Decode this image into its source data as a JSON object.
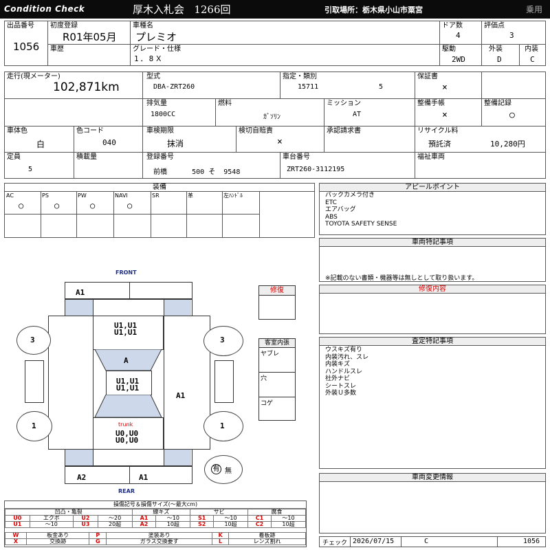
{
  "header": {
    "brand": "Condition Check",
    "auction": "厚木入札会",
    "lot_session": "1266回",
    "pickup": "引取場所：栃木県小山市粟宮",
    "category": "乗用"
  },
  "listing": {
    "lot_label": "出品番号",
    "lot_value": "1056",
    "first_reg_label": "初度登録",
    "first_reg_value": "R01年05月",
    "model_label": "車種名",
    "model_value": "プレミオ",
    "history_label": "車歴",
    "history_value": "",
    "grade_label": "グレード・仕様",
    "grade_value": "1．8Ｘ",
    "doors_label": "ドア数",
    "doors_value": "4",
    "score_label": "評価点",
    "score_value": "3",
    "drive_label": "駆動",
    "drive_value": "2WD",
    "exterior_label": "外装",
    "exterior_value": "D",
    "interior_label": "内装",
    "interior_value": "C"
  },
  "specs": {
    "mileage_label": "走行(現メーター)",
    "mileage_value": "102,871km",
    "type_label": "型式",
    "type_value": "DBA-ZRT260",
    "designation_label": "指定・類別",
    "designation_value": "15711",
    "class_value": "5",
    "warranty_label": "保証書",
    "warranty_value": "×",
    "displacement_label": "排気量",
    "displacement_value": "1800CC",
    "fuel_label": "燃料",
    "fuel_value": "ｶﾞｿﾘﾝ",
    "mission_label": "ミッション",
    "mission_value": "AT",
    "manual_label": "整備手帳",
    "manual_value": "×",
    "record_label": "整備記録",
    "record_value": "○",
    "body_color_label": "車体色",
    "body_color_value": "白",
    "color_code_label": "色コード",
    "color_code_value": "040",
    "inspection_label": "車検期限",
    "inspection_value": "抹消",
    "insurance_label": "検切自賠責",
    "insurance_value": "×",
    "approval_label": "承認請求書",
    "approval_value": "",
    "recycle_label": "リサイクル料",
    "recycle_status": "預託済",
    "recycle_value": "10,280円",
    "capacity_label": "定員",
    "capacity_value": "5",
    "load_label": "積載量",
    "load_value": "",
    "reg_no_label": "登録番号",
    "reg_area": "前橋",
    "reg_class": "500",
    "reg_kana": "そ",
    "reg_no": "9548",
    "chassis_label": "車台番号",
    "chassis_value": "ZRT260-3112195",
    "welfare_label": "福祉車両",
    "welfare_value": ""
  },
  "equipment": {
    "title": "装備",
    "items": [
      {
        "label": "AC",
        "value": "○"
      },
      {
        "label": "PS",
        "value": "○"
      },
      {
        "label": "PW",
        "value": "○"
      },
      {
        "label": "NAVI",
        "value": "○"
      },
      {
        "label": "SR",
        "value": ""
      },
      {
        "label": "革",
        "value": ""
      },
      {
        "label": "左ﾊﾝﾄﾞﾙ",
        "value": ""
      }
    ]
  },
  "appeal": {
    "title": "アピールポイント",
    "lines": [
      "バックカメラ付き",
      "ETC",
      "エアバッグ",
      "ABS",
      "TOYOTA SAFETY SENSE"
    ]
  },
  "vehicle_notes": {
    "title": "車両特記事項",
    "footnote": "※記載のない書類・機器等は無しとして取り扱います。"
  },
  "repair_content": {
    "title": "修復内容"
  },
  "inspection_notes": {
    "title": "査定特記事項",
    "lines": [
      "ウスキズ有り",
      "内装汚れ、スレ",
      "内装キズ",
      "ハンドルスレ",
      "社外ナビ",
      "シートスレ",
      "外装Ｕ多数"
    ]
  },
  "change_info": {
    "title": "車両変更情報"
  },
  "check": {
    "label": "チェック",
    "date": "2026/07/15",
    "grade": "C",
    "number": "1056"
  },
  "diagram": {
    "front": "FRONT",
    "rear": "REAR",
    "trunk": "trunk",
    "repair_label": "修復",
    "cabin_label": "客室内張",
    "cabin_items": [
      "ヤブレ",
      "穴",
      "コゲ"
    ],
    "marks": {
      "front_bumper": "A1",
      "hood": "U1,U1\nU1,U1",
      "windshield": "A",
      "roof": "U1,U1\nU1,U1",
      "right_side": "A1",
      "trunk_marks": "U0,U0\nU0,U0",
      "rear_bumper_left": "A2",
      "rear_bumper_right": "A1",
      "tire_fl": "3",
      "tire_fr": "3",
      "tire_rl": "1",
      "tire_rr": "1"
    },
    "spare_has": "有",
    "spare_none": "無"
  },
  "legend": {
    "title": "損傷記号＆損傷サイズ(～最大cm)",
    "groups": [
      {
        "name": "凹凸・亀裂",
        "rows": [
          [
            "U0",
            "エクボ",
            "U2",
            "～20"
          ],
          [
            "U1",
            "～10",
            "U3",
            "20超"
          ]
        ]
      },
      {
        "name": "線キズ",
        "rows": [
          [
            "A1",
            "～10"
          ],
          [
            "A2",
            "10超"
          ]
        ]
      },
      {
        "name": "サビ",
        "rows": [
          [
            "S1",
            "～10"
          ],
          [
            "S2",
            "10超"
          ]
        ]
      },
      {
        "name": "腐食",
        "rows": [
          [
            "C1",
            "～10"
          ],
          [
            "C2",
            "10超"
          ]
        ]
      }
    ],
    "bottom": [
      [
        "W",
        "板金あり",
        "P",
        "塗装あり",
        "K",
        "着板跡"
      ],
      [
        "X",
        "交換跡",
        "G",
        "ガラス交換要す",
        "L",
        "レンズ割れ"
      ]
    ]
  }
}
